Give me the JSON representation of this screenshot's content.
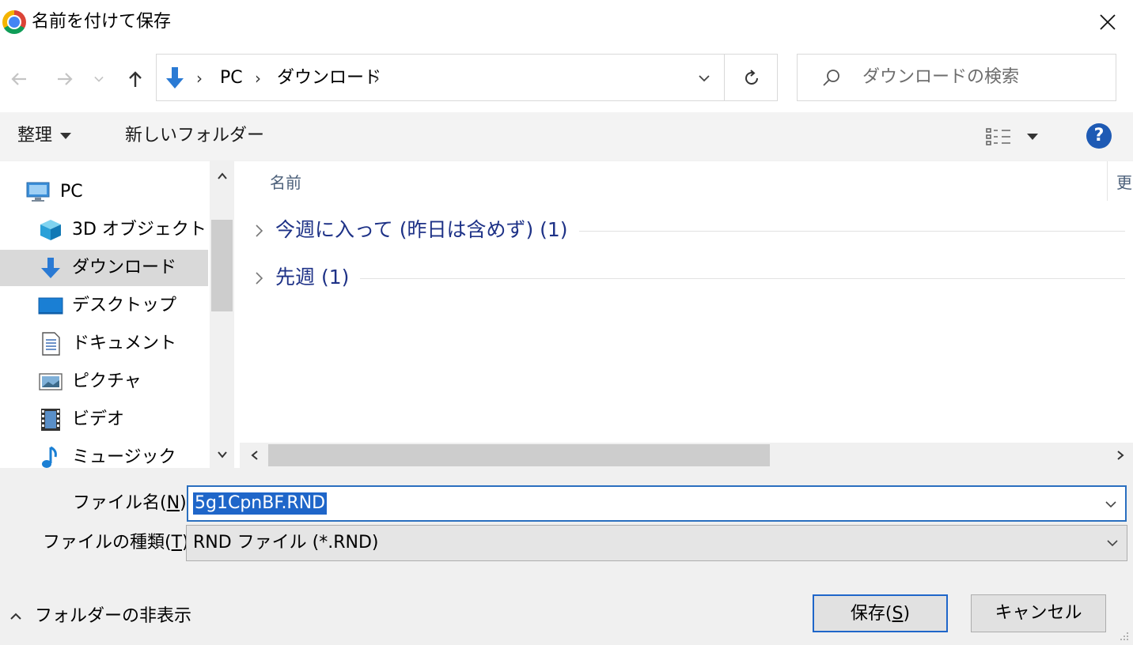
{
  "window": {
    "title": "名前を付けて保存"
  },
  "nav": {
    "breadcrumb": [
      "PC",
      "ダウンロード"
    ],
    "search_placeholder": "ダウンロードの検索"
  },
  "toolbar": {
    "organize_label": "整理",
    "new_folder_label": "新しいフォルダー",
    "help_label": "?"
  },
  "sidebar": {
    "items": [
      {
        "label": "PC",
        "icon": "pc-icon"
      },
      {
        "label": "3D オブジェクト",
        "icon": "3d-objects-icon"
      },
      {
        "label": "ダウンロード",
        "icon": "download-icon",
        "selected": true
      },
      {
        "label": "デスクトップ",
        "icon": "desktop-icon"
      },
      {
        "label": "ドキュメント",
        "icon": "documents-icon"
      },
      {
        "label": "ピクチャ",
        "icon": "pictures-icon"
      },
      {
        "label": "ビデオ",
        "icon": "video-icon"
      },
      {
        "label": "ミュージック",
        "icon": "music-icon"
      }
    ]
  },
  "filelist": {
    "columns": [
      "名前",
      "更"
    ],
    "groups": [
      {
        "label": "今週に入って (昨日は含めず) (1)"
      },
      {
        "label": "先週 (1)"
      }
    ]
  },
  "form": {
    "filename_label_prefix": "ファイル名(",
    "filename_label_key": "N",
    "filename_label_suffix": "):",
    "filename_value": "5g1CpnBF.RND",
    "filetype_label_prefix": "ファイルの種類(",
    "filetype_label_key": "T",
    "filetype_label_suffix": "):",
    "filetype_value": "RND ファイル (*.RND)"
  },
  "footer": {
    "hide_folders_label": "フォルダーの非表示",
    "save_prefix": "保存(",
    "save_key": "S",
    "save_suffix": ")",
    "cancel_label": "キャンセル"
  },
  "colors": {
    "accent": "#1f66c9",
    "group_text": "#1e3287",
    "selected_bg": "#d9d9d9"
  }
}
